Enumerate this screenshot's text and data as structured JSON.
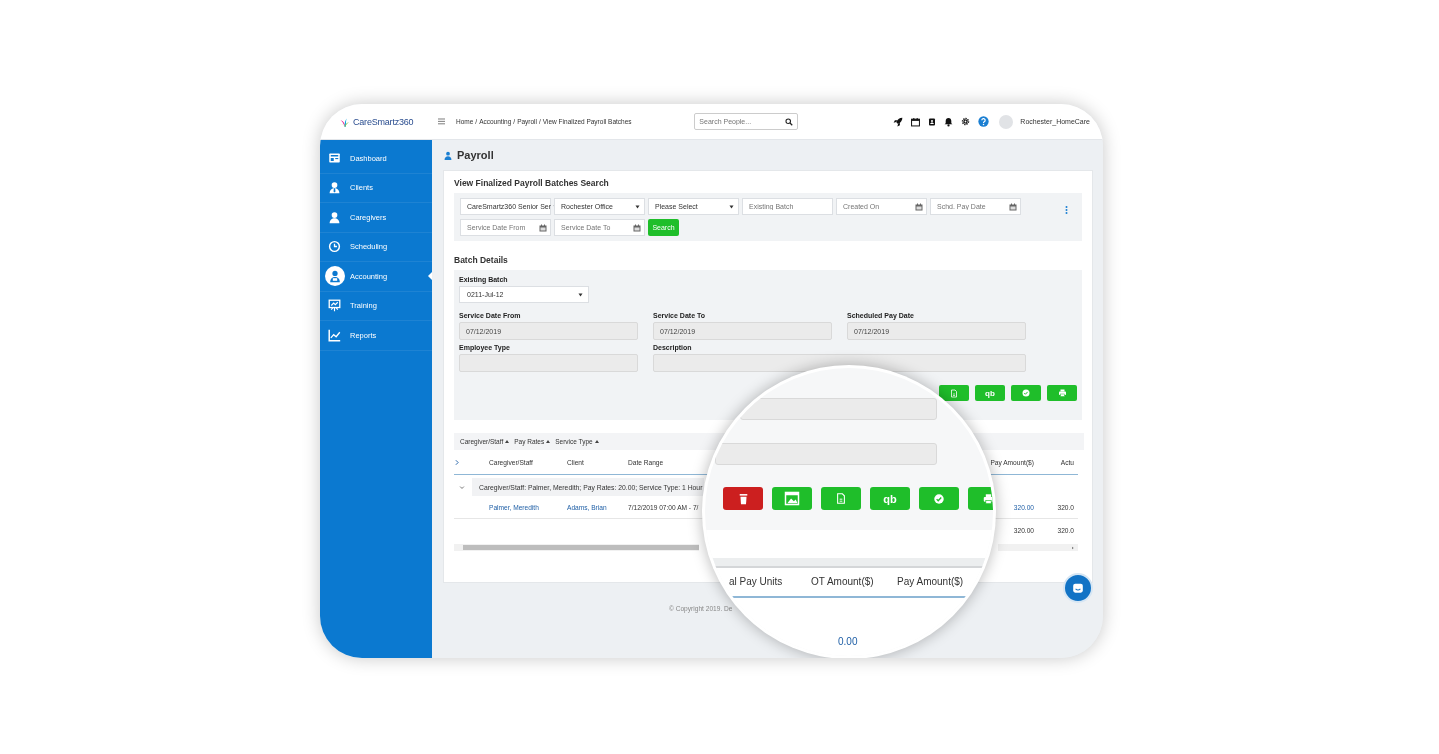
{
  "logo": {
    "name": "CareSmartz360"
  },
  "topbar": {
    "breadcrumb": [
      "Home",
      "Accounting",
      "Payroll",
      "View Finalized Payroll Batches"
    ],
    "breadcrumb_separator": "/",
    "search": {
      "placeholder": "Search People..."
    },
    "user": "Rochester_HomeCare"
  },
  "sidebar": {
    "items": [
      {
        "label": "Dashboard",
        "kind": "dashboard",
        "selected": false
      },
      {
        "label": "Clients",
        "kind": "clients",
        "selected": false
      },
      {
        "label": "Caregivers",
        "kind": "caregivers",
        "selected": false
      },
      {
        "label": "Scheduling",
        "kind": "scheduling",
        "selected": false
      },
      {
        "label": "Accounting",
        "kind": "accounting",
        "selected": true
      },
      {
        "label": "Training",
        "kind": "training",
        "selected": false
      },
      {
        "label": "Reports",
        "kind": "reports",
        "selected": false
      }
    ]
  },
  "page_title": "Payroll",
  "search_panel": {
    "title": "View Finalized Payroll Batches Search",
    "filters": [
      {
        "kind": "select",
        "value": "CareSmartz360 Senior Ser"
      },
      {
        "kind": "select",
        "value": "Rochester Office"
      },
      {
        "kind": "select",
        "value": "Please Select"
      },
      {
        "kind": "text",
        "placeholder": "Existing Batch"
      },
      {
        "kind": "date",
        "placeholder": "Created On"
      },
      {
        "kind": "date",
        "placeholder": "Schd. Pay Date"
      },
      {
        "kind": "date",
        "placeholder": "Service Date From"
      },
      {
        "kind": "date",
        "placeholder": "Service Date To"
      }
    ],
    "button": "Search"
  },
  "batch_details": {
    "title": "Batch Details",
    "existing_batch": {
      "label": "Existing Batch",
      "value": "0211-Jul-12"
    },
    "fields": [
      {
        "label": "Service Date From",
        "value": "07/12/2019"
      },
      {
        "label": "Service Date To",
        "value": "07/12/2019"
      },
      {
        "label": "Scheduled Pay Date",
        "value": "07/12/2019"
      },
      {
        "label": "Employee Type"
      },
      {
        "label": "Description",
        "wide": true
      }
    ],
    "actions": [
      {
        "kind": "document"
      },
      {
        "kind": "text",
        "label": "qb"
      },
      {
        "kind": "check"
      },
      {
        "kind": "print"
      }
    ]
  },
  "grid": {
    "group_by": [
      "Caregiver/Staff",
      "Pay Rates",
      "Service Type"
    ],
    "columns": [
      "Caregiver/Staff",
      "Client",
      "Date Range",
      "Pay Amount($)",
      "Actu"
    ],
    "group": {
      "label": "Caregiver/Staff: Palmer, Meredith; Pay Rates: 20.00; Service Type: 1 Hour",
      "expanded": true
    },
    "rows": [
      {
        "cells": [
          "Palmer, Meredith",
          "Adams, Brian",
          "7/12/2019 07:00 AM - 7/",
          "320.00",
          "320.0"
        ]
      }
    ],
    "totals": [
      "320.00",
      "320.0"
    ]
  },
  "footer": "© Copyright 2019. De",
  "magnifier": {
    "actions": [
      {
        "kind": "delete"
      },
      {
        "kind": "image"
      },
      {
        "kind": "document"
      },
      {
        "kind": "text",
        "label": "qb"
      },
      {
        "kind": "check"
      },
      {
        "kind": "print"
      }
    ],
    "columns": [
      "al Pay Units",
      "OT Amount($)",
      "Pay Amount($)"
    ],
    "total": "0.00"
  }
}
